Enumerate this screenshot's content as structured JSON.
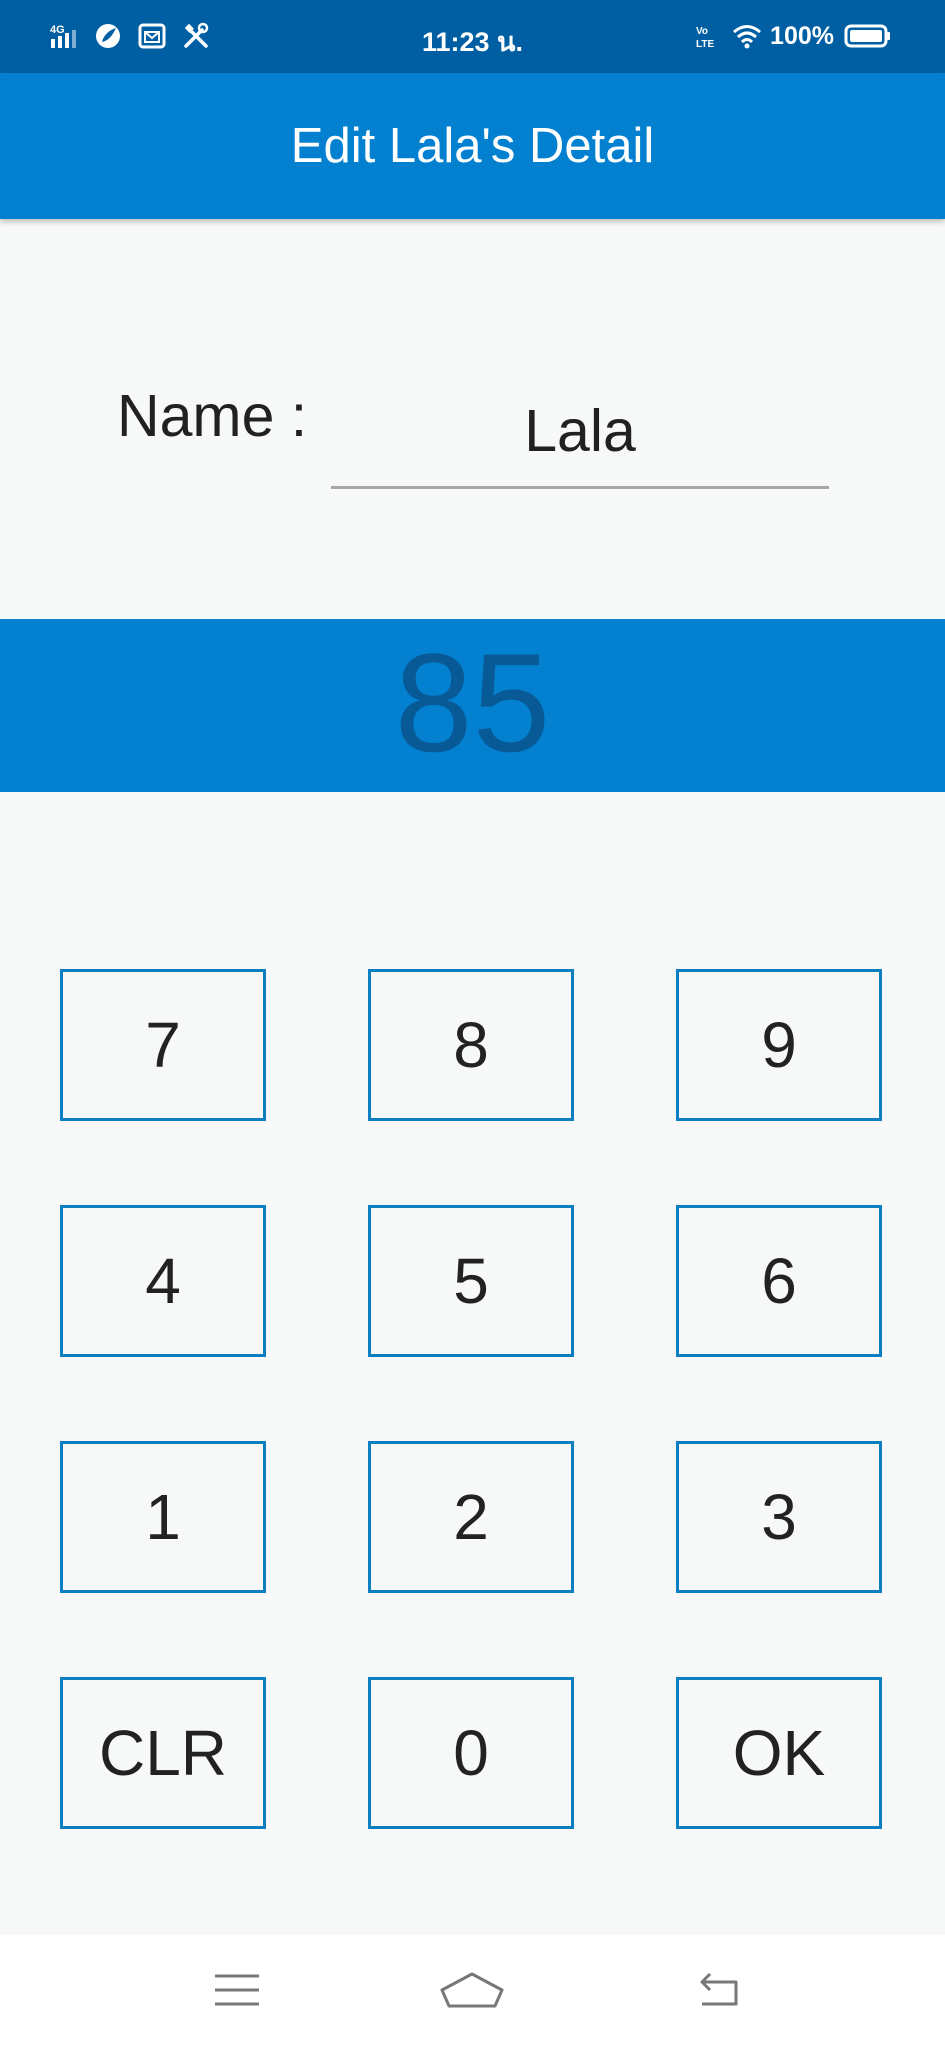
{
  "status_bar": {
    "network": "4G",
    "time": "11:23 น.",
    "volte": "VoLTE",
    "battery": "100%",
    "icons": [
      "signal-icon",
      "leaf-icon",
      "mail-icon",
      "tools-icon",
      "volte-icon",
      "wifi-icon",
      "battery-icon"
    ]
  },
  "app_bar": {
    "title": "Edit Lala's Detail"
  },
  "form": {
    "name_label": "Name :",
    "name_value": "Lala"
  },
  "display": {
    "value": "85"
  },
  "keypad": {
    "keys": [
      "7",
      "8",
      "9",
      "4",
      "5",
      "6",
      "1",
      "2",
      "3",
      "CLR",
      "0",
      "OK"
    ]
  },
  "nav_bar": {
    "icons": [
      "menu-icon",
      "home-icon",
      "back-icon"
    ]
  },
  "colors": {
    "status_bar": "#005fa3",
    "primary": "#0480d1",
    "display_text": "#075a95",
    "key_border": "#0c7fc0",
    "background": "#f7f8f8"
  }
}
